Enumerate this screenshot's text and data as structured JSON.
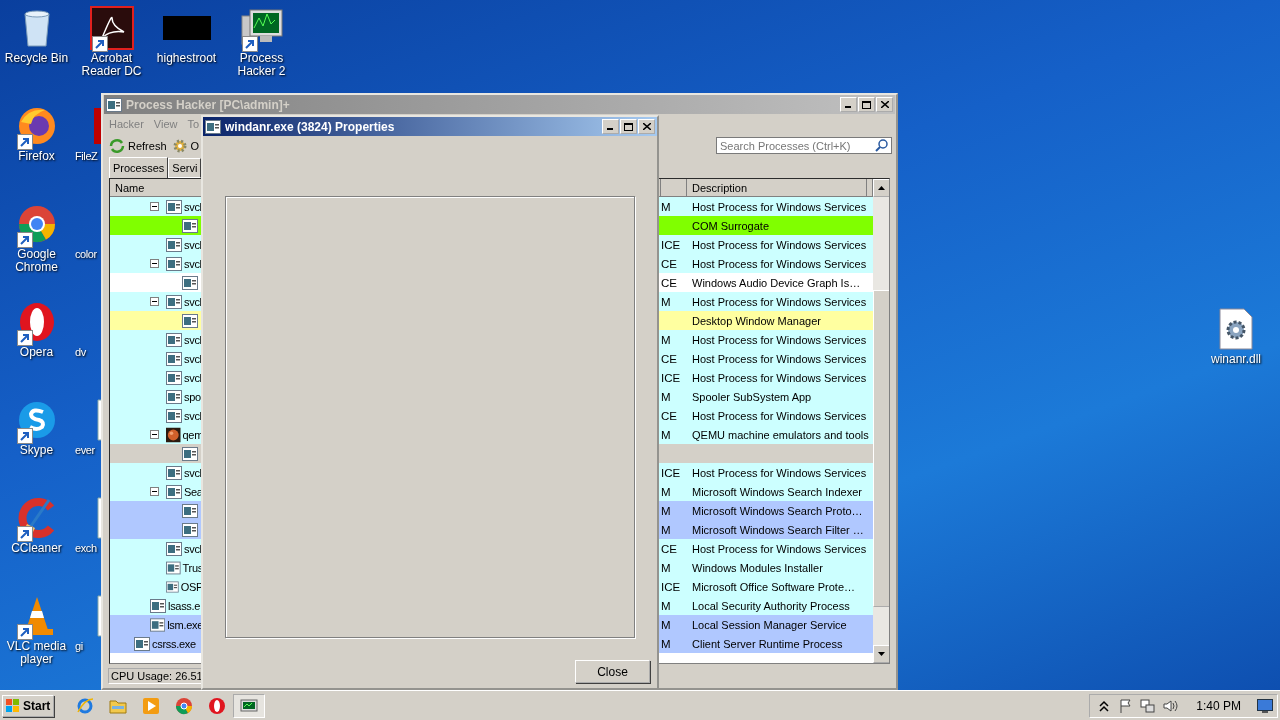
{
  "desktop_icons": [
    {
      "label": "Recycle Bin",
      "kind": "recycle",
      "shortcut": false
    },
    {
      "label": "Firefox",
      "kind": "firefox",
      "shortcut": true
    },
    {
      "label": "Google Chrome",
      "kind": "chrome",
      "shortcut": true
    },
    {
      "label": "Opera",
      "kind": "opera",
      "shortcut": true
    },
    {
      "label": "Skype",
      "kind": "skype",
      "shortcut": true
    },
    {
      "label": "CCleaner",
      "kind": "ccleaner",
      "shortcut": true
    },
    {
      "label": "VLC media player",
      "kind": "vlc",
      "shortcut": true
    },
    {
      "label": "Acrobat Reader DC",
      "kind": "acrobat",
      "shortcut": true
    },
    {
      "label": "FileZ",
      "kind": "filezilla",
      "shortcut": false
    },
    {
      "label": "color",
      "kind": "unknown",
      "shortcut": false
    },
    {
      "label": "dv",
      "kind": "unknown",
      "shortcut": false
    },
    {
      "label": "ever",
      "kind": "doc",
      "shortcut": false
    },
    {
      "label": "exch",
      "kind": "doc",
      "shortcut": false
    },
    {
      "label": "gi",
      "kind": "doc",
      "shortcut": false
    },
    {
      "label": "highestroot",
      "kind": "blank",
      "shortcut": false
    },
    {
      "label": "Process Hacker 2",
      "kind": "processhacker",
      "shortcut": true
    }
  ],
  "desktop_file": {
    "label": "winanr.dll"
  },
  "main_window": {
    "title": "Process Hacker [PC\\admin]+",
    "menu": [
      "Hacker",
      "View",
      "To"
    ],
    "toolbar": [
      {
        "label": "Refresh",
        "kind": "refresh"
      },
      {
        "label": "O",
        "kind": "options"
      }
    ],
    "search": {
      "placeholder": "Search Processes (Ctrl+K)"
    },
    "tabs": [
      {
        "label": "Processes",
        "selected": true
      },
      {
        "label": "Servi",
        "selected": false
      }
    ],
    "columns": [
      "Name",
      "Description"
    ],
    "process_tree": [
      {
        "children": [
          {
            "children": [
              {
                "name": "svcl",
                "kind": "app",
                "color": "#ccffff",
                "column_2": "M",
                "description": "Host Process for Windows Services",
                "expanded": true,
                "children": [
                  {
                    "kind": "app",
                    "color": "#80ff00",
                    "description": "COM Surrogate"
                  }
                ]
              },
              {
                "name": "svcl",
                "kind": "app",
                "color": "#ccffff",
                "column_2": "ICE",
                "description": "Host Process for Windows Services"
              },
              {
                "name": "svcl",
                "kind": "app",
                "color": "#ccffff",
                "column_2": "CE",
                "description": "Host Process for Windows Services",
                "expanded": true,
                "children": [
                  {
                    "kind": "app",
                    "color": "#ffffff",
                    "column_2": "CE",
                    "description": "Windows Audio Device Graph Is…"
                  }
                ]
              },
              {
                "name": "svcl",
                "kind": "app",
                "color": "#ccffff",
                "column_2": "M",
                "description": "Host Process for Windows Services",
                "expanded": true,
                "children": [
                  {
                    "kind": "app",
                    "color": "#ffffa0",
                    "description": "Desktop Window Manager"
                  }
                ]
              },
              {
                "name": "svcl",
                "kind": "app",
                "color": "#ccffff",
                "column_2": "M",
                "description": "Host Process for Windows Services"
              },
              {
                "name": "svcl",
                "kind": "app",
                "color": "#ccffff",
                "column_2": "CE",
                "description": "Host Process for Windows Services"
              },
              {
                "name": "svcl",
                "kind": "app",
                "color": "#ccffff",
                "column_2": "ICE",
                "description": "Host Process for Windows Services"
              },
              {
                "name": "spo",
                "kind": "app",
                "color": "#ccffff",
                "column_2": "M",
                "description": "Spooler SubSystem App"
              },
              {
                "name": "svcl",
                "kind": "app",
                "color": "#ccffff",
                "column_2": "CE",
                "description": "Host Process for Windows Services"
              },
              {
                "name": "qem",
                "kind": "qemu",
                "color": "#ccffff",
                "column_2": "M",
                "description": "QEMU machine emulators and tools",
                "expanded": true,
                "children": [
                  {
                    "kind": "app",
                    "color": "#d4d0c8"
                  }
                ]
              },
              {
                "name": "svcl",
                "kind": "app",
                "color": "#ccffff",
                "column_2": "ICE",
                "description": "Host Process for Windows Services"
              },
              {
                "name": "Sea",
                "kind": "app",
                "color": "#ccffff",
                "column_2": "M",
                "description": "Microsoft Windows Search Indexer",
                "expanded": true,
                "children": [
                  {
                    "kind": "app",
                    "color": "#b0c8ff",
                    "column_2": "M",
                    "description": "Microsoft Windows Search Proto…"
                  },
                  {
                    "kind": "app",
                    "color": "#b0c8ff",
                    "column_2": "M",
                    "description": "Microsoft Windows Search Filter …"
                  }
                ]
              },
              {
                "name": "svcl",
                "kind": "app",
                "color": "#ccffff",
                "column_2": "CE",
                "description": "Host Process for Windows Services"
              },
              {
                "name": "Trus",
                "kind": "app",
                "color": "#ccffff",
                "column_2": "M",
                "description": "Windows Modules Installer"
              },
              {
                "name": "OSP",
                "kind": "app",
                "color": "#ccffff",
                "column_2": "ICE",
                "description": "Microsoft Office Software Prote…"
              }
            ]
          },
          {
            "name": "lsass.e",
            "kind": "app",
            "color": "#ccffff",
            "column_2": "M",
            "description": "Local Security Authority Process"
          },
          {
            "name": "lsm.exe",
            "kind": "app",
            "color": "#b0c8ff",
            "column_2": "M",
            "description": "Local Session Manager Service"
          }
        ]
      },
      {
        "name": "csrss.exe",
        "kind": "app",
        "color": "#b0c8ff",
        "column_2": "M",
        "description": "Client Server Runtime Process"
      }
    ],
    "status": "CPU Usage: 26.51"
  },
  "dialog": {
    "title": "windanr.exe (3824) Properties",
    "button": "Close"
  },
  "taskbar": {
    "start": "Start",
    "quick_launch": [
      {
        "kind": "ie"
      },
      {
        "kind": "explorer"
      },
      {
        "kind": "media"
      },
      {
        "kind": "chrome"
      },
      {
        "kind": "opera"
      }
    ],
    "windows": [
      {
        "kind": "processhacker",
        "selected": true
      }
    ],
    "tray": [
      {
        "kind": "arrow"
      },
      {
        "kind": "flag"
      },
      {
        "kind": "network"
      },
      {
        "kind": "speaker"
      }
    ],
    "time": "1:40 PM"
  }
}
